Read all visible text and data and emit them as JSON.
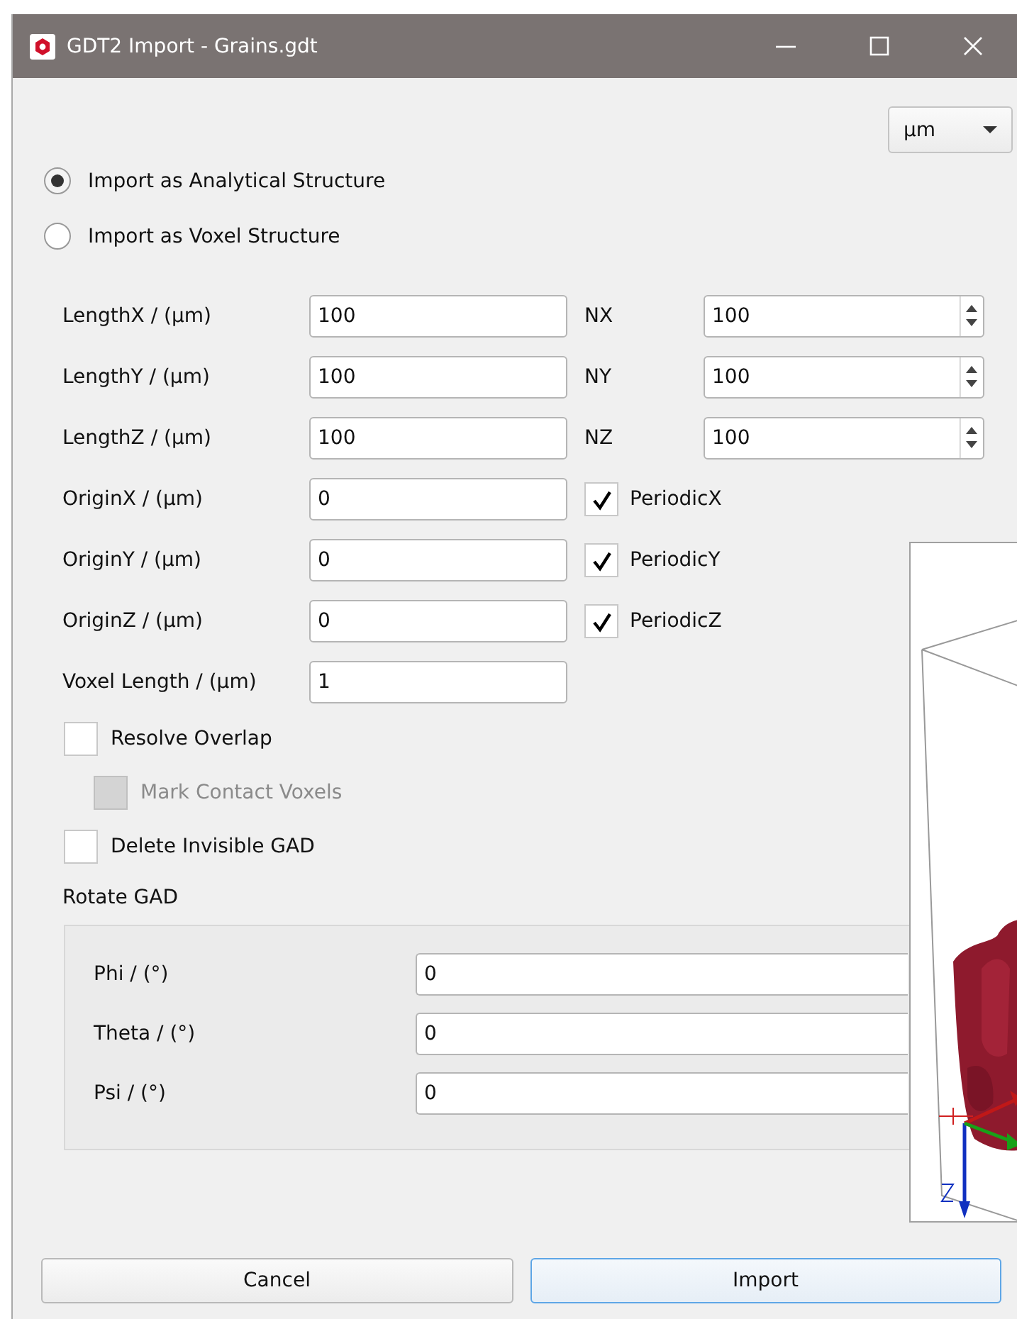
{
  "window": {
    "title": "GDT2 Import - Grains.gdt"
  },
  "unit_select": {
    "value": "µm"
  },
  "import_modes": [
    {
      "label": "Import as Analytical Structure",
      "selected": true
    },
    {
      "label": "Import as Voxel Structure",
      "selected": false
    }
  ],
  "dimension_rows": [
    {
      "label": "LengthX / (µm)",
      "value": "100",
      "extra": {
        "kind": "spin",
        "label": "NX",
        "value": "100"
      }
    },
    {
      "label": "LengthY / (µm)",
      "value": "100",
      "extra": {
        "kind": "spin",
        "label": "NY",
        "value": "100"
      }
    },
    {
      "label": "LengthZ / (µm)",
      "value": "100",
      "extra": {
        "kind": "spin",
        "label": "NZ",
        "value": "100"
      }
    },
    {
      "label": "OriginX / (µm)",
      "value": "0",
      "extra": {
        "kind": "checkbox",
        "label": "PeriodicX",
        "checked": true
      }
    },
    {
      "label": "OriginY / (µm)",
      "value": "0",
      "extra": {
        "kind": "checkbox",
        "label": "PeriodicY",
        "checked": true
      }
    },
    {
      "label": "OriginZ / (µm)",
      "value": "0",
      "extra": {
        "kind": "checkbox",
        "label": "PeriodicZ",
        "checked": true
      }
    },
    {
      "label": "Voxel Length / (µm)",
      "value": "1"
    }
  ],
  "options": [
    {
      "label": "Resolve Overlap",
      "checked": false,
      "disabled": false,
      "children": [
        {
          "label": "Mark Contact Voxels",
          "checked": false,
          "disabled": true
        }
      ]
    },
    {
      "label": "Delete Invisible GAD",
      "checked": false,
      "disabled": false
    }
  ],
  "rotate_group": {
    "title": "Rotate GAD",
    "fields": [
      {
        "label": "Phi / (°)",
        "value": "0"
      },
      {
        "label": "Theta / (°)",
        "value": "0"
      },
      {
        "label": "Psi / (°)",
        "value": "0"
      }
    ]
  },
  "buttons": [
    {
      "label": "Cancel",
      "default": false
    },
    {
      "label": "Import",
      "default": true
    }
  ]
}
